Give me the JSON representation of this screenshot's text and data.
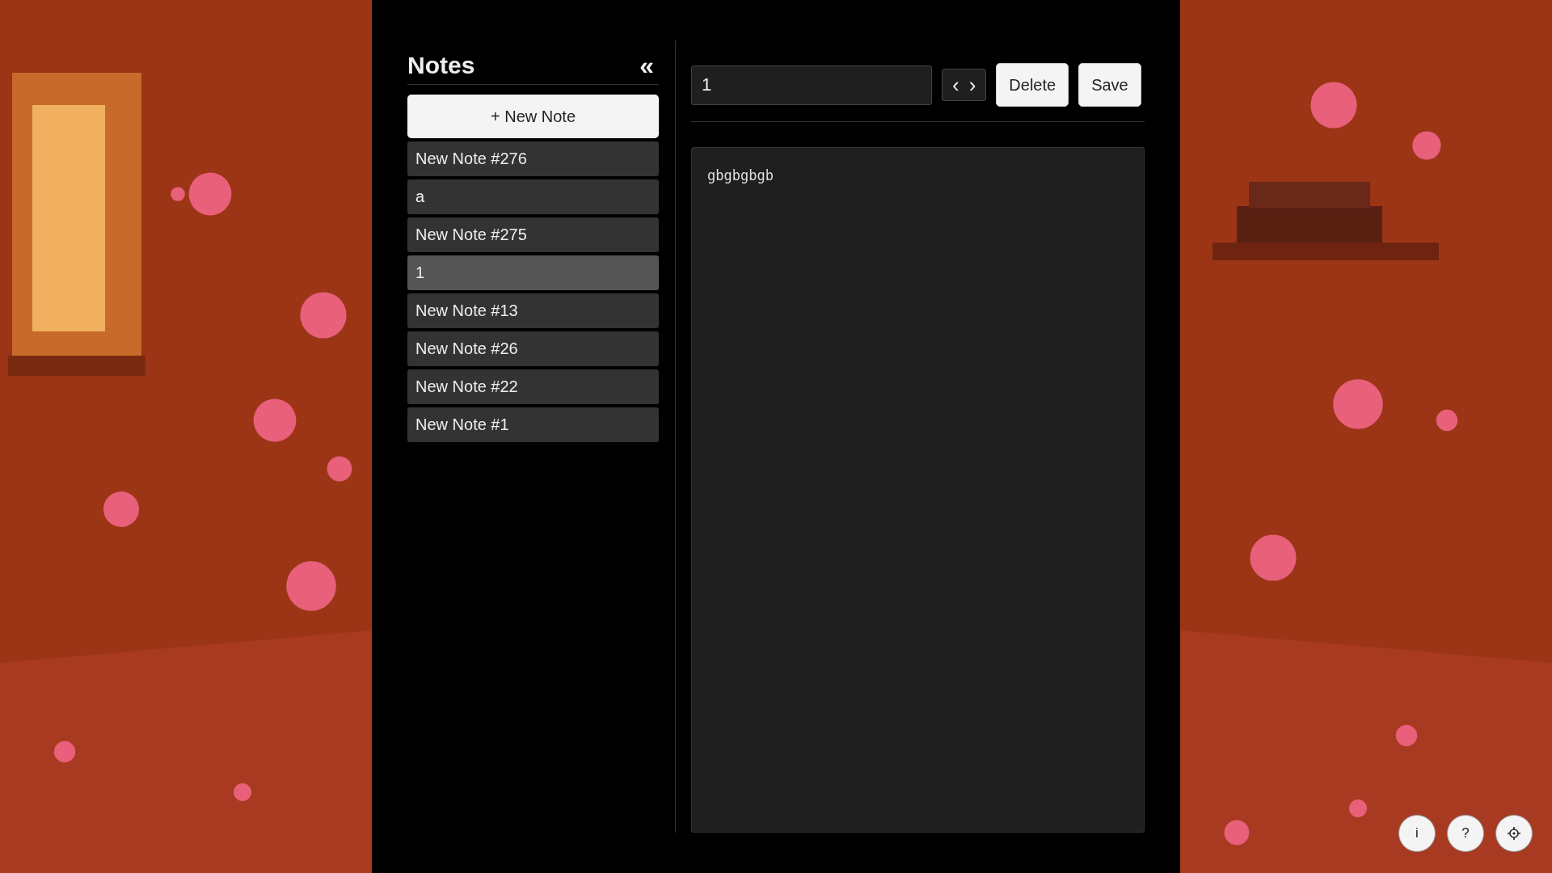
{
  "sidebar": {
    "title": "Notes",
    "collapse": "«",
    "new_note": "+ New Note",
    "notes": [
      {
        "title": "New Note #276",
        "selected": false
      },
      {
        "title": "a",
        "selected": false
      },
      {
        "title": "New Note #275",
        "selected": false
      },
      {
        "title": "1",
        "selected": true
      },
      {
        "title": "New Note #13",
        "selected": false
      },
      {
        "title": "New Note #26",
        "selected": false
      },
      {
        "title": "New Note #22",
        "selected": false
      },
      {
        "title": "New Note #1",
        "selected": false
      }
    ]
  },
  "editor": {
    "title_value": "1",
    "prev": "‹",
    "next": "›",
    "delete": "Delete",
    "save": "Save",
    "body": "gbgbgbgb"
  },
  "corner_buttons": [
    {
      "kind": "text",
      "label": "i"
    },
    {
      "kind": "text",
      "label": "?"
    },
    {
      "kind": "settings"
    }
  ]
}
